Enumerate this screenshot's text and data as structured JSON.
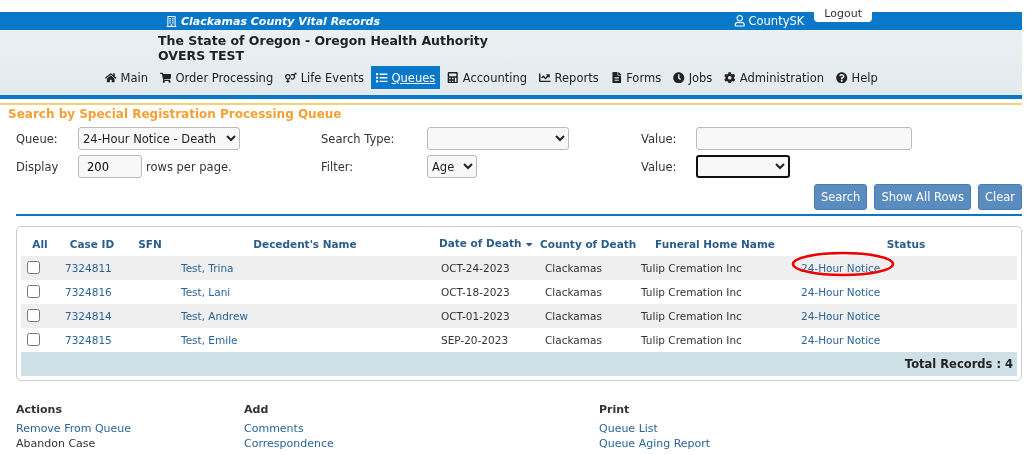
{
  "top_bar": {
    "title": "Clackamas County Vital Records",
    "user": "CountySK",
    "logout": "Logout"
  },
  "header": {
    "agency": "The State of Oregon - Oregon Health Authority",
    "environment": "OVERS TEST"
  },
  "nav": [
    {
      "label": "Main",
      "selected": false
    },
    {
      "label": "Order Processing",
      "selected": false
    },
    {
      "label": "Life Events",
      "selected": false
    },
    {
      "label": "Queues",
      "selected": true
    },
    {
      "label": "Accounting",
      "selected": false
    },
    {
      "label": "Reports",
      "selected": false
    },
    {
      "label": "Forms",
      "selected": false
    },
    {
      "label": "Jobs",
      "selected": false
    },
    {
      "label": "Administration",
      "selected": false
    },
    {
      "label": "Help",
      "selected": false
    }
  ],
  "search": {
    "title": "Search by Special Registration Processing Queue",
    "queue_label": "Queue:",
    "queue_value": "24-Hour Notice - Death",
    "display_label": "Display",
    "display_value": "200",
    "display_suffix": "rows per page.",
    "search_type_label": "Search Type:",
    "filter_label": "Filter:",
    "filter_value": "Age",
    "value_label": "Value:",
    "value2_label": "Value:",
    "buttons": [
      "Search",
      "Show All Rows",
      "Clear"
    ]
  },
  "table": {
    "columns": [
      "All",
      "Case ID",
      "SFN",
      "Decedent's Name",
      "Date of Death",
      "County of Death",
      "Funeral Home Name",
      "Status"
    ],
    "rows": [
      {
        "checked": false,
        "case_id": "7324811",
        "name": "Test, Trina",
        "date": "OCT-24-2023",
        "county": "Clackamas",
        "funeral_home": "Tulip Cremation Inc",
        "status": "24-Hour Notice",
        "circled": true
      },
      {
        "checked": false,
        "case_id": "7324816",
        "name": "Test, Lani",
        "date": "OCT-18-2023",
        "county": "Clackamas",
        "funeral_home": "Tulip Cremation Inc",
        "status": "24-Hour Notice",
        "circled": false
      },
      {
        "checked": false,
        "case_id": "7324814",
        "name": "Test, Andrew",
        "date": "OCT-01-2023",
        "county": "Clackamas",
        "funeral_home": "Tulip Cremation Inc",
        "status": "24-Hour Notice",
        "circled": false
      },
      {
        "checked": false,
        "case_id": "7324815",
        "name": "Test, Emile",
        "date": "SEP-20-2023",
        "county": "Clackamas",
        "funeral_home": "Tulip Cremation Inc",
        "status": "24-Hour Notice",
        "circled": false
      }
    ],
    "total": "Total Records : 4"
  },
  "actions": [
    {
      "heading": "Actions",
      "links": [
        "Remove From Queue",
        "Abandon Case"
      ]
    },
    {
      "heading": "Add",
      "links": [
        "Comments",
        "Correspondence"
      ]
    },
    {
      "heading": "Print",
      "links": [
        "Queue List",
        "Queue Aging Report"
      ]
    }
  ]
}
